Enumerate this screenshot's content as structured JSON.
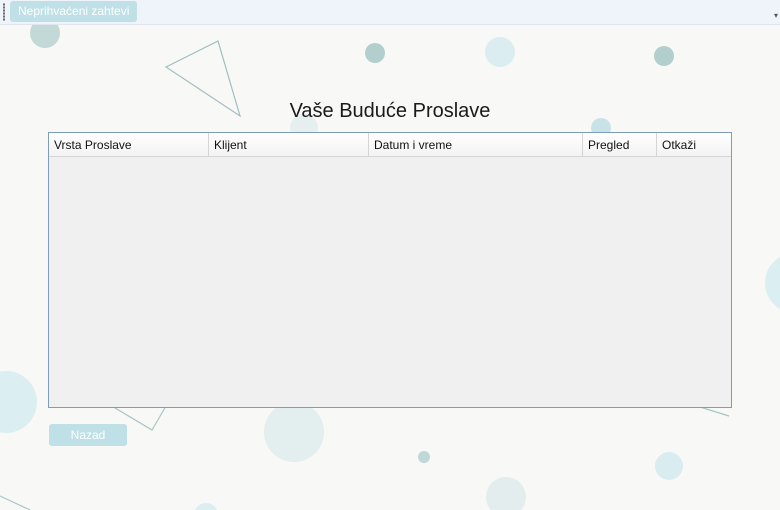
{
  "toolbar": {
    "pending_requests_label": "Neprihvaćeni zahtevi",
    "overflow_glyph": "▾"
  },
  "page": {
    "title": "Vaše Buduće Proslave"
  },
  "table": {
    "columns": [
      "Vrsta Proslave",
      "Klijent",
      "Datum i vreme",
      "Pregled",
      "Otkaži"
    ],
    "rows": []
  },
  "footer": {
    "back_label": "Nazad"
  },
  "colors": {
    "accent": "#bfe0e6",
    "grid_border": "#7f9db9",
    "grid_background": "#f0f0f0",
    "page_background": "#f8f8f6"
  }
}
